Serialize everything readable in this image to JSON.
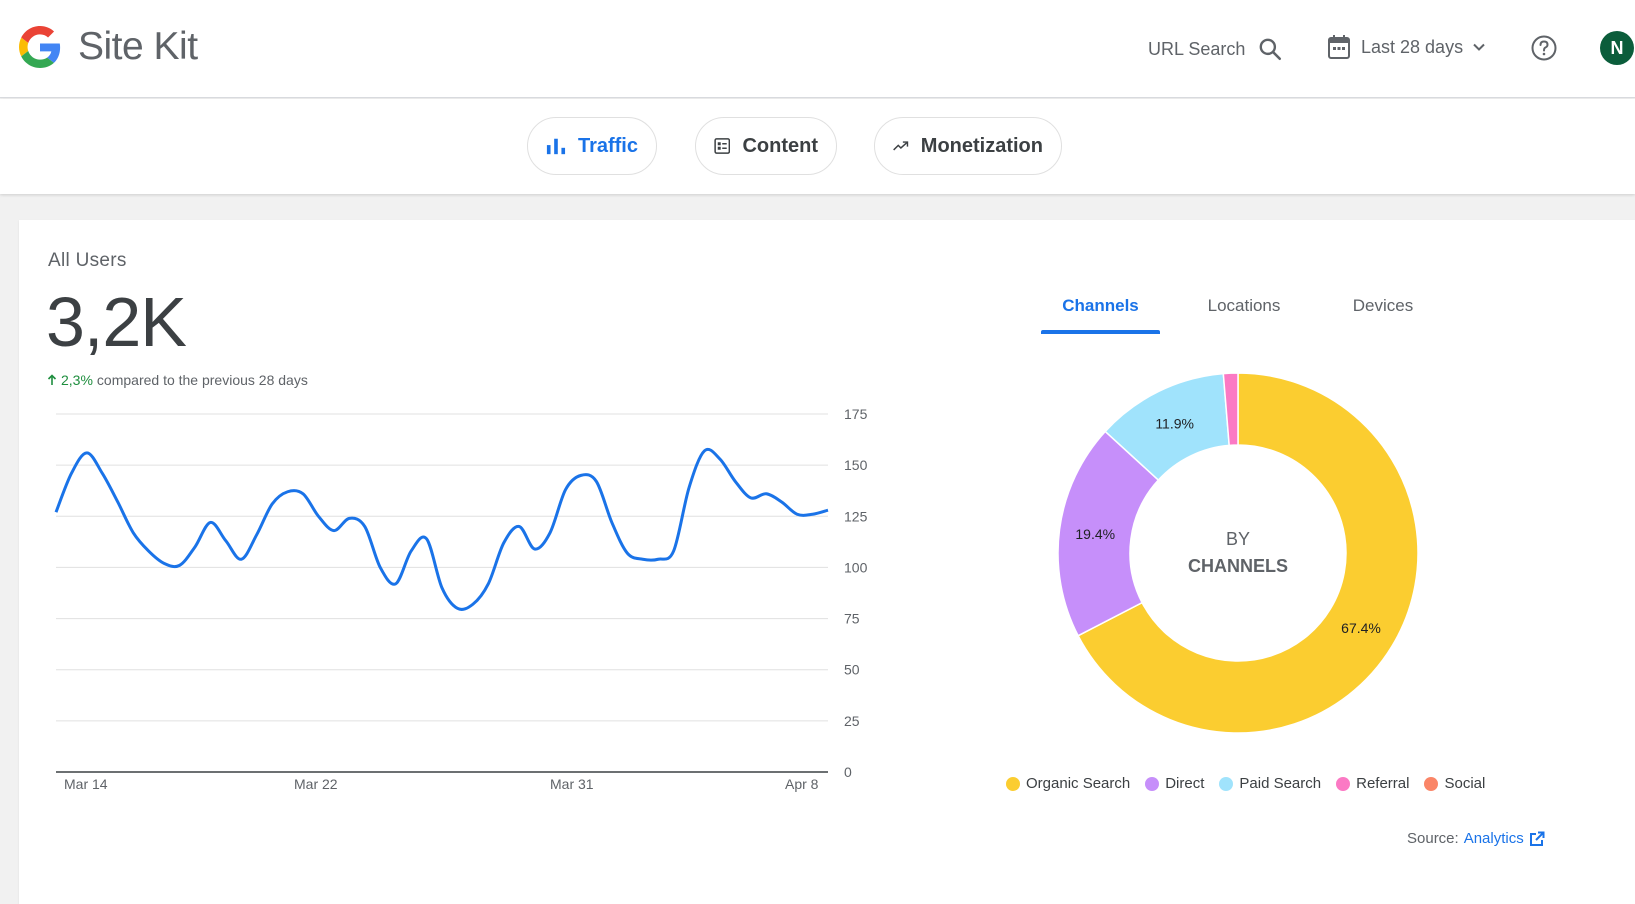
{
  "header": {
    "app_name": "Site Kit",
    "url_search_label": "URL Search",
    "date_range_label": "Last 28 days",
    "avatar_initial": "N"
  },
  "tabs": [
    {
      "label": "Traffic",
      "icon": "bar-chart-icon",
      "active": true
    },
    {
      "label": "Content",
      "icon": "content-list-icon",
      "active": false
    },
    {
      "label": "Monetization",
      "icon": "trending-up-icon",
      "active": false
    }
  ],
  "widget": {
    "title": "All Users",
    "value": "3,2K",
    "change_value": "2,3%",
    "change_text": "compared to the previous 28 days"
  },
  "chart_data": [
    {
      "type": "line",
      "title": "",
      "y_ticks": [
        "175",
        "150",
        "125",
        "100",
        "75",
        "50",
        "25",
        "0"
      ],
      "x_ticks": [
        "Mar 14",
        "Mar 22",
        "Mar 31",
        "Apr 8"
      ],
      "ylim": [
        0,
        175
      ],
      "grid": true,
      "color": "#1a73e8",
      "series": [
        {
          "values": [
            127,
            146,
            156,
            146,
            132,
            117,
            108,
            102,
            101,
            110,
            122,
            113,
            104,
            116,
            131,
            137,
            136,
            125,
            118,
            124,
            120,
            100,
            92,
            108,
            114,
            90,
            80,
            82,
            92,
            112,
            120,
            109,
            117,
            138,
            145,
            142,
            122,
            107,
            104,
            104,
            108,
            139,
            157,
            153,
            142,
            134,
            136,
            132,
            126,
            126,
            128
          ]
        }
      ]
    },
    {
      "type": "pie",
      "donut": true,
      "center_label_top": "BY",
      "center_label_bottom": "CHANNELS",
      "slices": [
        {
          "name": "Organic Search",
          "value": 67.4,
          "label": "67.4%",
          "color": "#fbcd30"
        },
        {
          "name": "Direct",
          "value": 19.4,
          "label": "19.4%",
          "color": "#c68ffa"
        },
        {
          "name": "Paid Search",
          "value": 11.9,
          "label": "11.9%",
          "color": "#a0e3fc"
        },
        {
          "name": "Referral",
          "value": 1.3,
          "label": "",
          "color": "#fb79c4"
        },
        {
          "name": "Social",
          "value": 0,
          "label": "",
          "color": "#fa8567"
        }
      ]
    }
  ],
  "dimension_tabs": [
    {
      "label": "Channels",
      "active": true
    },
    {
      "label": "Locations",
      "active": false
    },
    {
      "label": "Devices",
      "active": false
    }
  ],
  "legend": [
    {
      "label": "Organic Search",
      "color": "#fbcd30"
    },
    {
      "label": "Direct",
      "color": "#c68ffa"
    },
    {
      "label": "Paid Search",
      "color": "#a0e3fc"
    },
    {
      "label": "Referral",
      "color": "#fb79c4"
    },
    {
      "label": "Social",
      "color": "#fa8567"
    }
  ],
  "source": {
    "prefix": "Source:",
    "link_label": "Analytics"
  }
}
